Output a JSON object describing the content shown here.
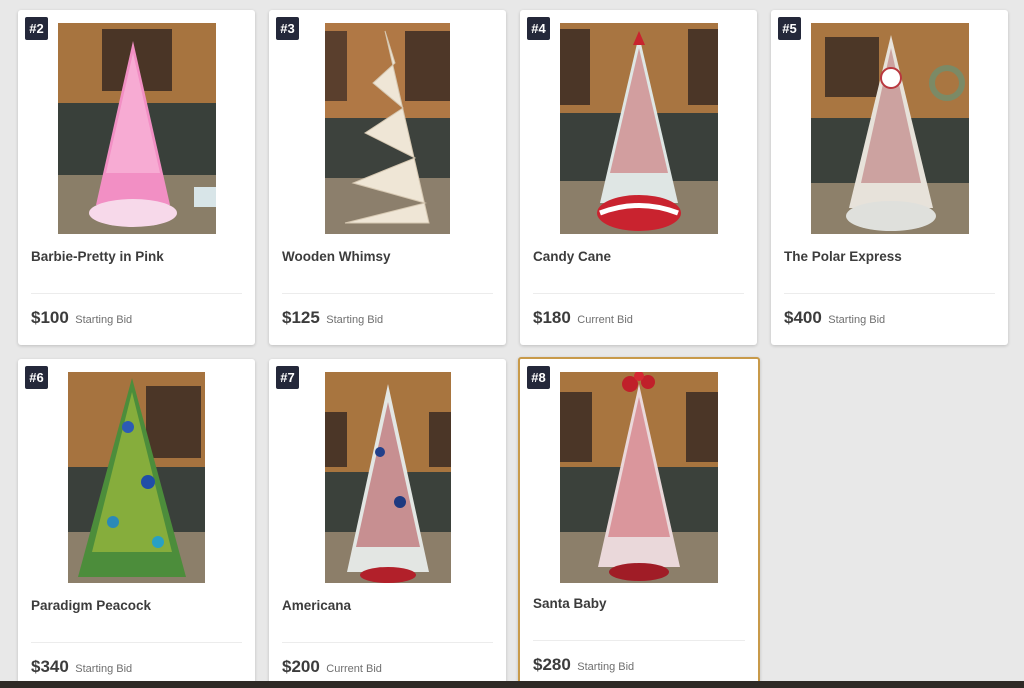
{
  "items": [
    {
      "number": "#2",
      "title": "Barbie-Pretty in Pink",
      "price": "$100",
      "bid_label": "Starting Bid",
      "theme": "pink"
    },
    {
      "number": "#3",
      "title": "Wooden Whimsy",
      "price": "$125",
      "bid_label": "Starting Bid",
      "theme": "wood"
    },
    {
      "number": "#4",
      "title": "Candy Cane",
      "price": "$180",
      "bid_label": "Current Bid",
      "theme": "candy"
    },
    {
      "number": "#5",
      "title": "The Polar Express",
      "price": "$400",
      "bid_label": "Starting Bid",
      "theme": "polar"
    },
    {
      "number": "#6",
      "title": "Paradigm Peacock",
      "price": "$340",
      "bid_label": "Starting Bid",
      "theme": "peacock"
    },
    {
      "number": "#7",
      "title": "Americana",
      "price": "$200",
      "bid_label": "Current Bid",
      "theme": "americana"
    },
    {
      "number": "#8",
      "title": "Santa Baby",
      "price": "$280",
      "bid_label": "Starting Bid",
      "theme": "santa"
    }
  ],
  "colors": {
    "badge_bg": "#24283a",
    "selected_border": "#c89a4a",
    "page_bg": "#e8e8e8"
  }
}
